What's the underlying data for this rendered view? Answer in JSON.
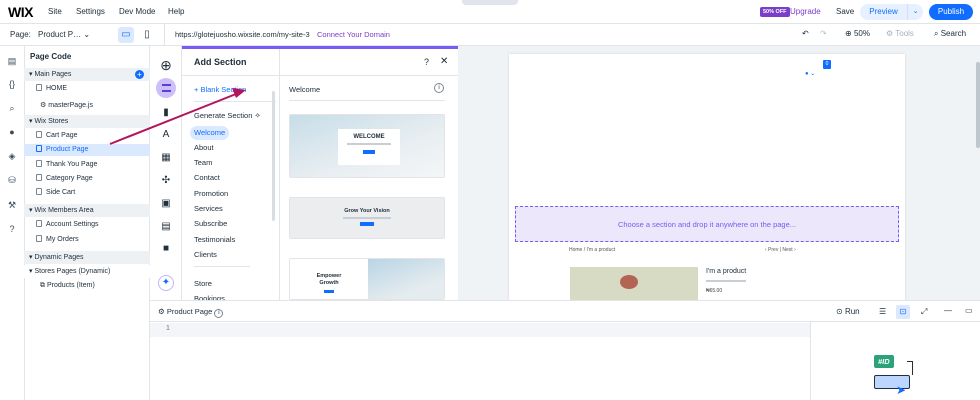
{
  "topbar": {
    "logo": "WIX",
    "menu": [
      "Site",
      "Settings",
      "Dev Mode",
      "Help"
    ],
    "badge": "50% OFF",
    "upgrade": "Upgrade",
    "save": "Save",
    "preview": "Preview",
    "publish": "Publish"
  },
  "bar2": {
    "page_label": "Page:",
    "page_value": "Product P…",
    "url": "https://glotejuosho.wixsite.com/my-site-3",
    "connect": "Connect Your Domain",
    "zoom": "50%",
    "tools": "Tools",
    "search": "Search"
  },
  "left": {
    "title": "Page Code",
    "sections": [
      {
        "label": "Main Pages",
        "items": [
          "HOME",
          "masterPage.js"
        ]
      },
      {
        "label": "Wix Stores",
        "items": [
          "Cart Page",
          "Product Page",
          "Thank You Page",
          "Category Page",
          "Side Cart"
        ]
      },
      {
        "label": "Wix Members Area",
        "items": [
          "Account Settings",
          "My Orders"
        ]
      },
      {
        "label": "Dynamic Pages",
        "items": []
      },
      {
        "label": "Stores Pages (Dynamic)",
        "items": [
          "Products (Item)"
        ]
      }
    ]
  },
  "addsection": {
    "title": "Add Section",
    "blank": "+ Blank Section",
    "categories": [
      "Generate Section",
      "Welcome",
      "About",
      "Team",
      "Contact",
      "Promotion",
      "Services",
      "Subscribe",
      "Testimonials",
      "Clients",
      "Store",
      "Bookings"
    ],
    "header": "Welcome",
    "thumb1_title": "WELCOME",
    "thumb2_title": "Grow Your Vision",
    "thumb3_title": "Empower Growth"
  },
  "canvas": {
    "drop": "Choose a section and drop it anywhere on the page...",
    "breadcrumb": "Home / I'm a product",
    "nav": "‹ Prev | Next ›",
    "product_name": "I'm a product",
    "price": "₦65.00"
  },
  "code": {
    "tab": "Product Page",
    "run": "Run",
    "line1": "1",
    "hid": "#ID"
  },
  "colors": {
    "accent": "#116dff",
    "purple": "#7a5af5",
    "upgrade": "#7a3ec9"
  }
}
